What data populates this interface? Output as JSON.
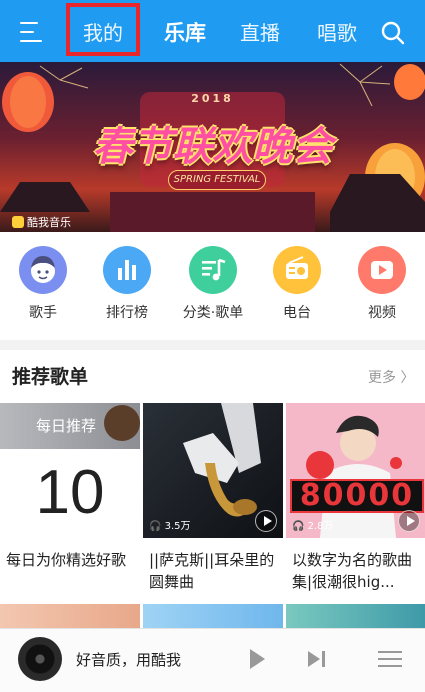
{
  "topbar": {
    "tabs": [
      {
        "label": "我的",
        "active": false,
        "highlighted": true
      },
      {
        "label": "乐库",
        "active": true
      },
      {
        "label": "直播",
        "active": false
      },
      {
        "label": "唱歌",
        "active": false
      }
    ],
    "menu_icon": "hamburger-menu-icon",
    "search_icon": "search-icon",
    "highlight_color": "#e8262b",
    "bar_color": "#1f9bf2"
  },
  "banner": {
    "year_text": "2018",
    "title": "春节联欢晚会",
    "subtitle": "SPRING FESTIVAL",
    "logo_text": "酷我音乐"
  },
  "categories": [
    {
      "label": "歌手",
      "icon": "singer-icon",
      "color": "#7b8ff0"
    },
    {
      "label": "排行榜",
      "icon": "chart-bars-icon",
      "color": "#4aa8f5"
    },
    {
      "label": "分类·歌单",
      "icon": "music-list-icon",
      "color": "#3fcf9c"
    },
    {
      "label": "电台",
      "icon": "radio-icon",
      "color": "#ffc23a"
    },
    {
      "label": "视频",
      "icon": "video-play-icon",
      "color": "#ff7a6a"
    }
  ],
  "section": {
    "title": "推荐歌单",
    "more_label": "更多 〉"
  },
  "playlists": [
    {
      "title": "每日为你精选好歌",
      "badge": "每日推荐",
      "day": "10"
    },
    {
      "title": "||萨克斯||耳朵里的圆舞曲",
      "play_count": "3.5万"
    },
    {
      "title": "以数字为名的歌曲集|很潮很hig...",
      "play_count": "2.8万",
      "cover_number": "80000"
    }
  ],
  "player": {
    "text": "好音质，用酷我",
    "play_icon": "play-icon",
    "next_icon": "next-track-icon",
    "list_icon": "playlist-icon"
  }
}
